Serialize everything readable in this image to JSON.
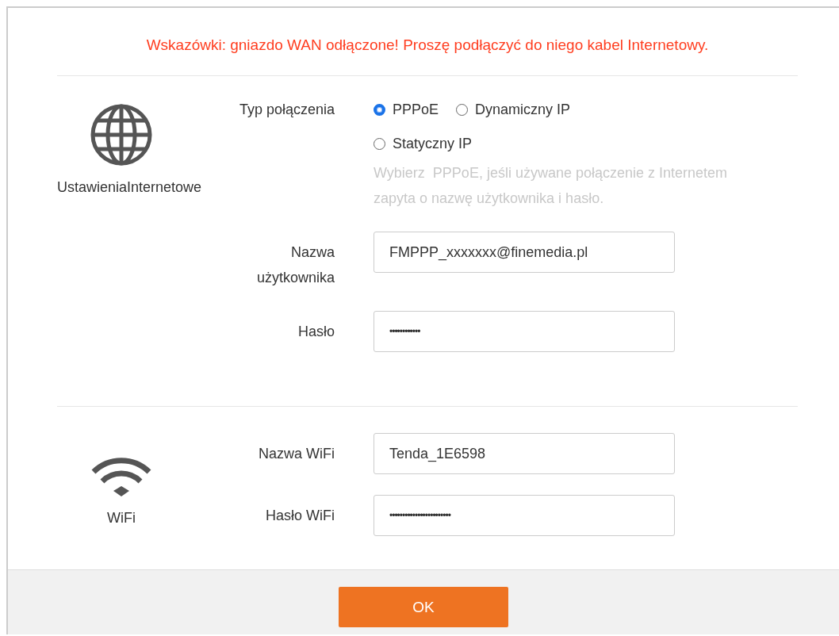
{
  "notice": "Wskazówki: gniazdo WAN odłączone! Proszę podłączyć do niego kabel Internetowy.",
  "sections": [
    {
      "kind": "internet",
      "title": "UstawieniaInternetowe",
      "fields": [
        {
          "kind": "radio",
          "label": "Typ połączenia",
          "options": [
            {
              "label": "PPPoE",
              "selected": true
            },
            {
              "label": "Dynamiczny IP",
              "selected": false
            },
            {
              "label": "Statyczny IP",
              "selected": false
            }
          ],
          "hint": "Wybierz  PPPoE, jeśli używane połączenie z Internetem zapyta o nazwę użytkownika i hasło."
        },
        {
          "kind": "text",
          "label": "Nazwa użytkownika",
          "value": "FMPPP_xxxxxxx@finemedia.pl"
        },
        {
          "kind": "password",
          "label": "Hasło",
          "value": "••••••••••••"
        }
      ]
    },
    {
      "kind": "wifi",
      "title": "WiFi",
      "fields": [
        {
          "kind": "text",
          "label": "Nazwa WiFi",
          "value": "Tenda_1E6598"
        },
        {
          "kind": "password",
          "label": "Hasło WiFi",
          "value": "••••••••••••••••••••••••"
        }
      ]
    }
  ],
  "ok_button": "OK"
}
